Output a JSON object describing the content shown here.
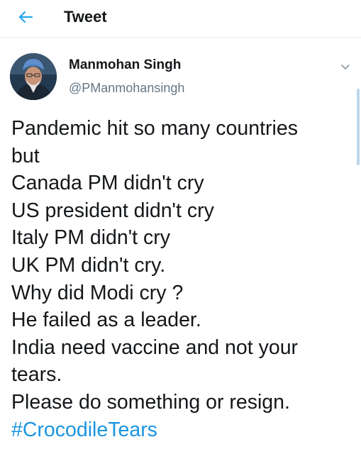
{
  "header": {
    "back_icon": "arrow-left-icon",
    "title": "Tweet",
    "accent_color": "#1da1f2"
  },
  "tweet": {
    "author": {
      "name": "Manmohan Singh",
      "handle": "@PManmohansingh",
      "avatar_icon": "profile-photo"
    },
    "caret_icon": "chevron-down-icon",
    "lines": [
      "Pandemic hit so many countries",
      "but",
      "Canada PM didn't cry",
      "US president didn't cry",
      "Italy PM didn't cry",
      "UK PM didn't cry.",
      "Why did Modi cry ?",
      "He failed as a leader.",
      "India need vaccine and not your",
      "tears.",
      "Please do something or resign."
    ],
    "hashtag": "#CrocodileTears",
    "hashtag_color": "#1b95e0"
  }
}
